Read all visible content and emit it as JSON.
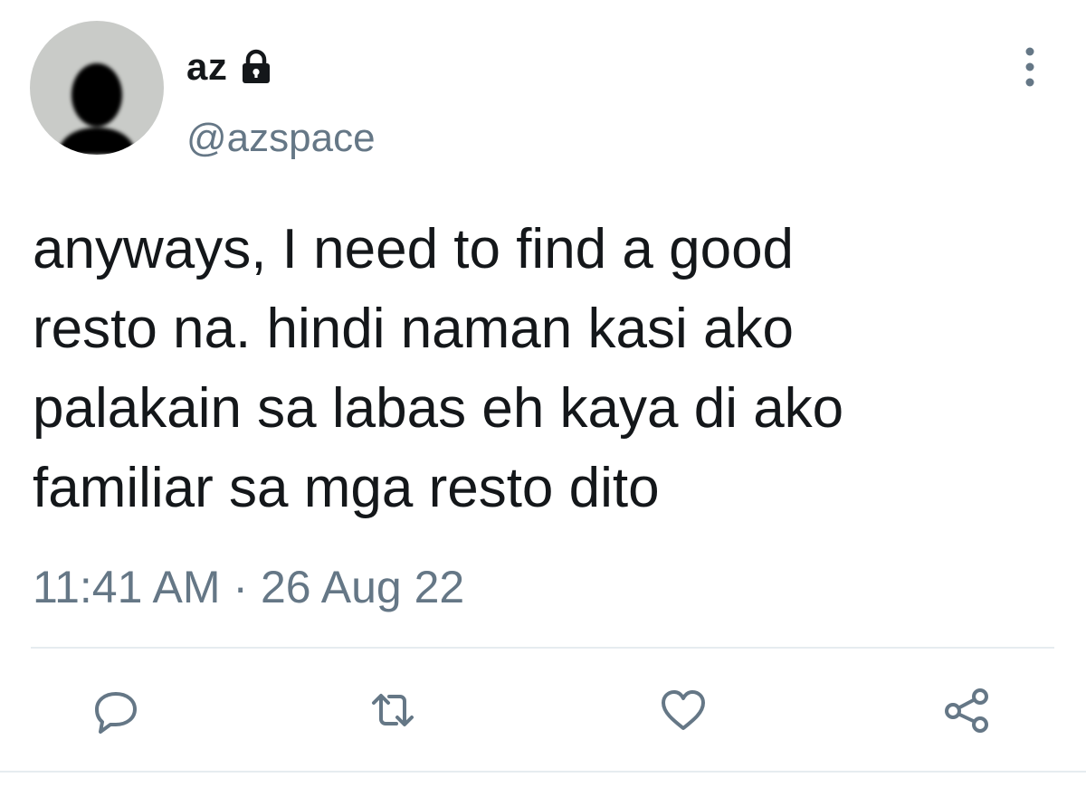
{
  "tweet": {
    "display_name": "az",
    "handle": "@azspace",
    "protected_icon": "lock-icon",
    "text_lines": [
      "anyways, I need to find a good",
      "resto na. hindi naman kasi ako",
      "palakain sa labas eh kaya di ako",
      "familiar sa mga resto dito"
    ],
    "timestamp": "11:41 AM · 26 Aug 22",
    "actions": [
      {
        "name": "reply",
        "icon": "reply-icon"
      },
      {
        "name": "retweet",
        "icon": "retweet-icon"
      },
      {
        "name": "like",
        "icon": "heart-icon"
      },
      {
        "name": "share",
        "icon": "share-icon"
      }
    ],
    "menu_icon": "more-vertical-icon"
  },
  "colors": {
    "text_primary": "#14171a",
    "text_secondary": "#657786",
    "icon": "#657786",
    "divider": "#e6ecf0",
    "avatar_bg": "#c9cbc8"
  }
}
